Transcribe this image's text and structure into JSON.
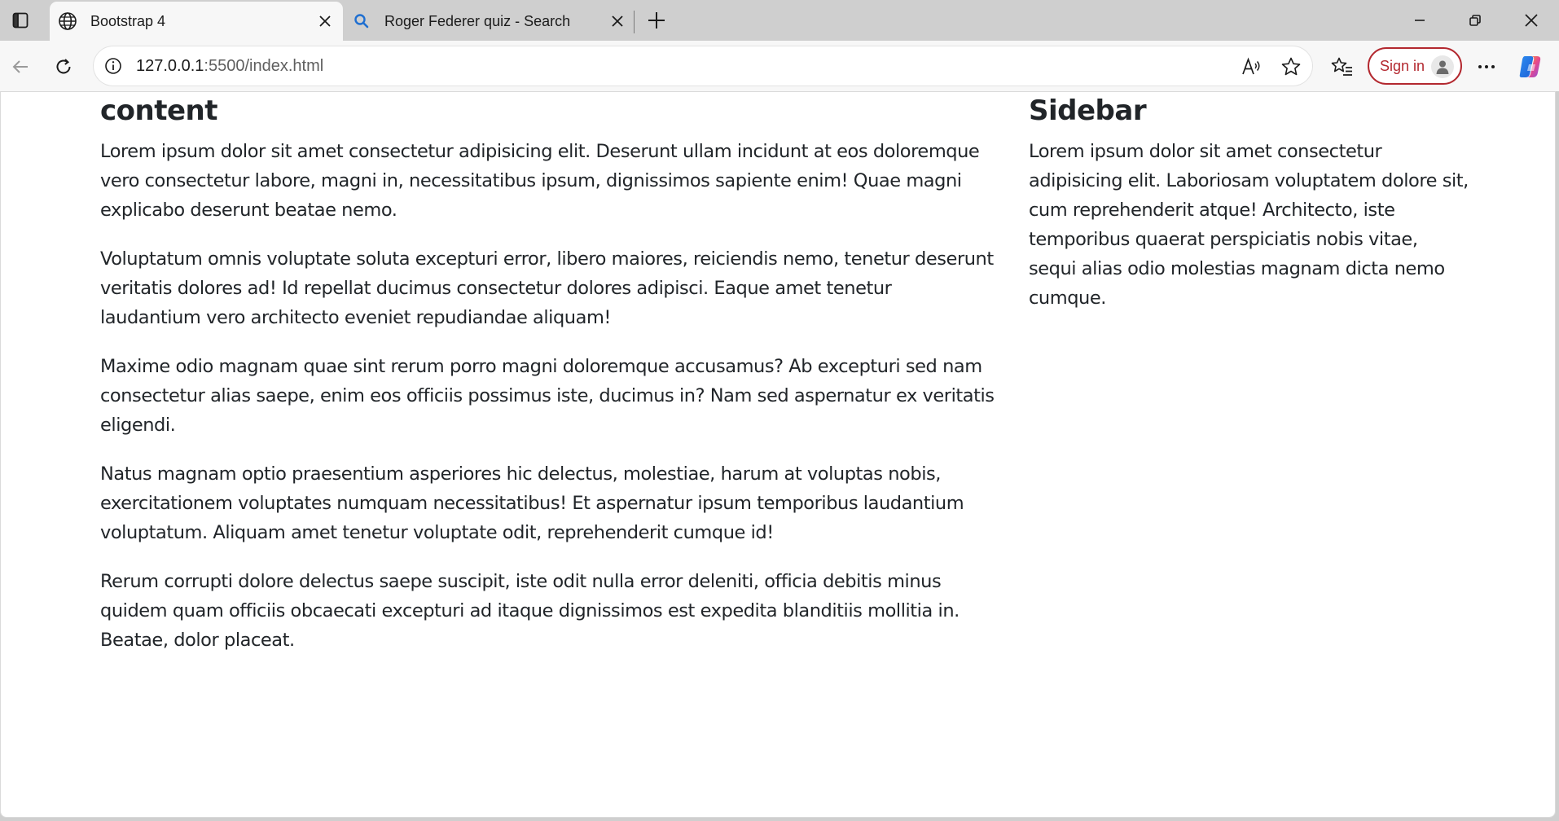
{
  "tabs": [
    {
      "title": "Bootstrap 4",
      "favicon": "globe-icon",
      "active": true
    },
    {
      "title": "Roger Federer quiz - Search",
      "favicon": "search-icon",
      "active": false
    }
  ],
  "address_bar": {
    "host": "127.0.0.1",
    "rest": ":5500/index.html"
  },
  "account": {
    "sign_in_label": "Sign in"
  },
  "colors": {
    "signin_accent": "#b3282f",
    "text": "#212529",
    "chrome_bg": "#cfcfcf"
  },
  "page": {
    "main": {
      "heading": "content",
      "paragraphs": [
        "Lorem ipsum dolor sit amet consectetur adipisicing elit. Deserunt ullam incidunt at eos doloremque vero consectetur labore, magni in, necessitatibus ipsum, dignissimos sapiente enim! Quae magni explicabo deserunt beatae nemo.",
        "Voluptatum omnis voluptate soluta excepturi error, libero maiores, reiciendis nemo, tenetur deserunt veritatis dolores ad! Id repellat ducimus consectetur dolores adipisci. Eaque amet tenetur laudantium vero architecto eveniet repudiandae aliquam!",
        "Maxime odio magnam quae sint rerum porro magni doloremque accusamus? Ab excepturi sed nam consectetur alias saepe, enim eos officiis possimus iste, ducimus in? Nam sed aspernatur ex veritatis eligendi.",
        "Natus magnam optio praesentium asperiores hic delectus, molestiae, harum at voluptas nobis, exercitationem voluptates numquam necessitatibus! Et aspernatur ipsum temporibus laudantium voluptatum. Aliquam amet tenetur voluptate odit, reprehenderit cumque id!",
        "Rerum corrupti dolore delectus saepe suscipit, iste odit nulla error deleniti, officia debitis minus quidem quam officiis obcaecati excepturi ad itaque dignissimos est expedita blanditiis mollitia in. Beatae, dolor placeat."
      ]
    },
    "sidebar": {
      "heading": "Sidebar",
      "paragraphs": [
        "Lorem ipsum dolor sit amet consectetur adipisicing elit. Laboriosam voluptatem dolore sit, cum reprehenderit atque! Architecto, iste temporibus quaerat perspiciatis nobis vitae, sequi alias odio molestias magnam dicta nemo cumque."
      ]
    }
  }
}
